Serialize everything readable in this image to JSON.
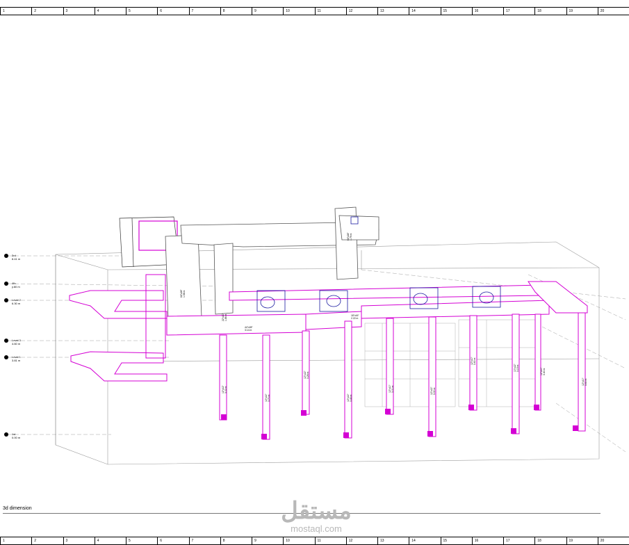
{
  "ruler": {
    "cells": [
      "1",
      "2",
      "3",
      "4",
      "5",
      "6",
      "7",
      "8",
      "9",
      "10",
      "11",
      "12",
      "13",
      "14",
      "15",
      "16",
      "17",
      "18",
      "19",
      "20"
    ]
  },
  "levels": [
    {
      "name": "3rd",
      "elev": "8.41 m"
    },
    {
      "name": "4th",
      "elev": "y.60 m"
    },
    {
      "name": "Level 2",
      "elev": "6.30 m"
    },
    {
      "name": "Level 3",
      "elev": "4.60 m"
    },
    {
      "name": "Level 1",
      "elev": "3.81 m"
    },
    {
      "name": "1st",
      "elev": "0.00 m"
    }
  ],
  "duct_tags": [
    {
      "size": "44\"x28\"",
      "len": "3.14 m"
    },
    {
      "size": "64\"x28\"",
      "len": "1.58 m"
    },
    {
      "size": "22\"x20\"",
      "len": "1.86 m"
    },
    {
      "size": "64\"x28\"",
      "len": "1.79 m"
    },
    {
      "size": "18\"x16\"",
      "len": "2.22 m"
    },
    {
      "size": "12\"x12\"",
      "len": "3.02 m"
    },
    {
      "size": "12\"x12\"",
      "len": "3.70 m"
    },
    {
      "size": "12\"x12\"",
      "len": "3.26 m"
    },
    {
      "size": "12\"x12\"",
      "len": "3.43 m"
    },
    {
      "size": "12\"x10\"",
      "len": "3.01 m"
    },
    {
      "size": "12\"x12\"",
      "len": "3.30 m"
    },
    {
      "size": "12\"x10\"",
      "len": "3.60 m"
    },
    {
      "size": "10\"x12\"",
      "len": "3.15 m"
    },
    {
      "size": "12\"x10\"",
      "len": "3.40 m"
    },
    {
      "size": "12\"x10\"",
      "len": "3.60 m"
    }
  ],
  "caption": "3d dimension",
  "watermark": {
    "arabic": "مستقل",
    "latin": "mostaql.com"
  },
  "colors": {
    "duct": "#d400d4",
    "duct_dark": "#1a1aa0",
    "outline": "#555555",
    "building": "#9a9a9a"
  }
}
